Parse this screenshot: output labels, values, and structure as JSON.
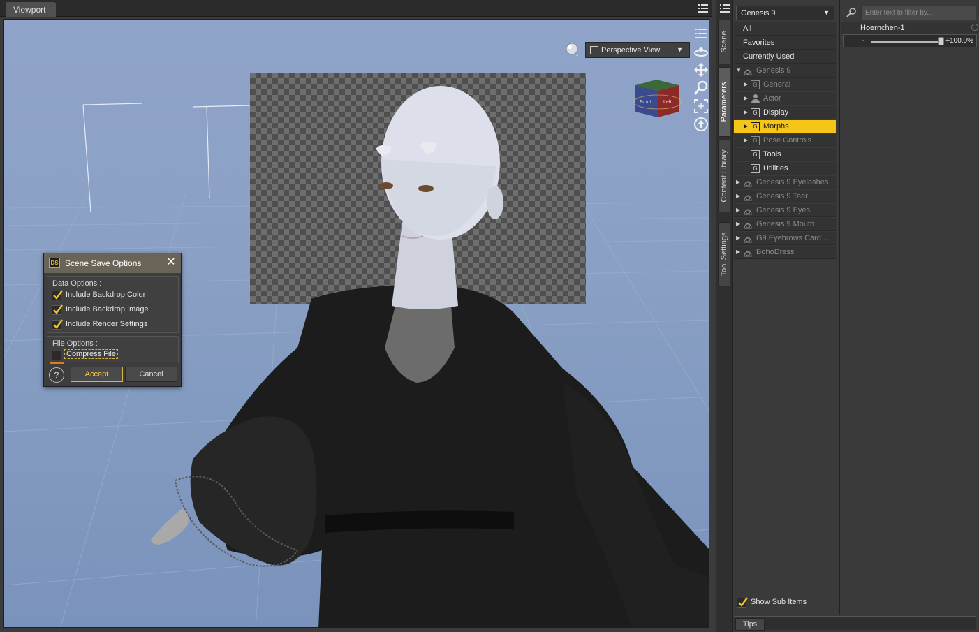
{
  "viewport": {
    "tab_label": "Viewport",
    "view_dropdown": "Perspective View",
    "nav_cube_labels": [
      "Front",
      "Left"
    ]
  },
  "dialog": {
    "logo": "DS",
    "title": "Scene Save Options",
    "data_options_label": "Data Options :",
    "options": [
      {
        "label": "Include Backdrop Color",
        "checked": true
      },
      {
        "label": "Include Backdrop Image",
        "checked": true
      },
      {
        "label": "Include Render Settings",
        "checked": true
      }
    ],
    "file_options_label": "File Options :",
    "compress_label": "Compress File",
    "compress_checked": false,
    "help_label": "?",
    "accept_label": "Accept",
    "cancel_label": "Cancel"
  },
  "side_tabs": [
    "Scene",
    "Parameters",
    "Content Library",
    "Tool Settings"
  ],
  "tree": {
    "figure_select": "Genesis 9",
    "top_items": [
      "All",
      "Favorites",
      "Currently Used"
    ],
    "nodes": [
      {
        "label": "Genesis 9",
        "type": "figure",
        "expanded": true,
        "dim": true
      },
      {
        "label": "General",
        "type": "group",
        "dim": true
      },
      {
        "label": "Actor",
        "type": "actor",
        "dim": true
      },
      {
        "label": "Display",
        "type": "group",
        "dim": false
      },
      {
        "label": "Morphs",
        "type": "group",
        "dim": false,
        "selected": true
      },
      {
        "label": "Pose Controls",
        "type": "group",
        "dim": true
      },
      {
        "label": "Tools",
        "type": "group",
        "dim": false,
        "leaf": true
      },
      {
        "label": "Utilities",
        "type": "group",
        "dim": false,
        "leaf": true
      },
      {
        "label": "Genesis 9 Eyelashes",
        "type": "figure",
        "dim": true
      },
      {
        "label": "Genesis 9 Tear",
        "type": "figure",
        "dim": true
      },
      {
        "label": "Genesis 9 Eyes",
        "type": "figure",
        "dim": true
      },
      {
        "label": "Genesis 9 Mouth",
        "type": "figure",
        "dim": true
      },
      {
        "label": "G9 Eyebrows Card ...",
        "type": "figure",
        "dim": true
      },
      {
        "label": "BohoDress",
        "type": "figure",
        "dim": true
      }
    ],
    "show_sub_items_label": "Show Sub Items",
    "show_sub_items_checked": true,
    "tips_label": "Tips"
  },
  "properties": {
    "filter_placeholder": "Enter text to filter by...",
    "item_name": "Hoernchen-1",
    "value": "100.0%",
    "value_fraction": 1.0,
    "minus_label": "-",
    "plus_label": "+"
  }
}
